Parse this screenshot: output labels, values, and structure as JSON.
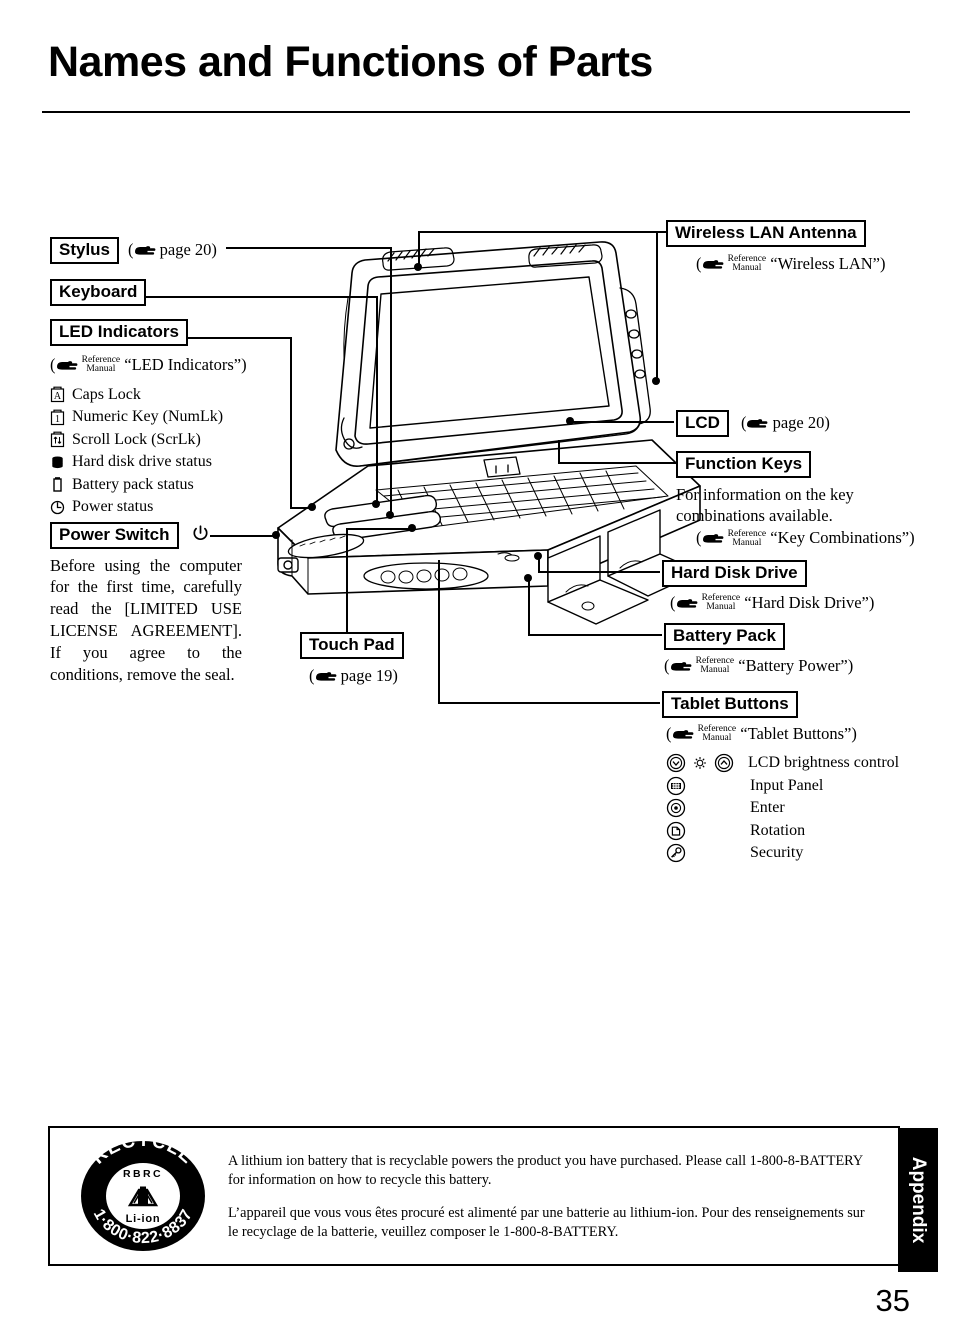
{
  "page": {
    "title": "Names and Functions of Parts",
    "number": "35",
    "tab": "Appendix"
  },
  "ref_manual": {
    "line1": "Reference",
    "line2": "Manual"
  },
  "callouts": {
    "stylus": {
      "label": "Stylus",
      "note": "( page 20)",
      "note_page": "page 20)"
    },
    "keyboard": {
      "label": "Keyboard"
    },
    "led_indicators": {
      "label": "LED Indicators",
      "ref": "“LED Indicators”)",
      "items": [
        {
          "icon": "caps-lock-icon",
          "text": "Caps Lock"
        },
        {
          "icon": "numeric-key-icon",
          "text": "Numeric Key (NumLk)"
        },
        {
          "icon": "scroll-lock-icon",
          "text": "Scroll Lock (ScrLk)"
        },
        {
          "icon": "hard-disk-status-icon",
          "text": "Hard disk drive status"
        },
        {
          "icon": "battery-status-icon",
          "text": "Battery pack status"
        },
        {
          "icon": "power-status-icon",
          "text": "Power status"
        }
      ]
    },
    "power_switch": {
      "label": "Power Switch",
      "body": "Before using the computer for the first time, carefully read the [LIMITED USE LICENSE AGREEMENT]. If you agree to the conditions, remove the seal."
    },
    "touch_pad": {
      "label": "Touch Pad",
      "note_page": "page 19)"
    },
    "wireless_lan": {
      "label": "Wireless LAN Antenna",
      "ref": "“Wireless LAN”)"
    },
    "lcd": {
      "label": "LCD",
      "note_page": "page 20)"
    },
    "function_keys": {
      "label": "Function Keys",
      "body": "For information on the key combinations available.",
      "ref": "“Key Combinations”)"
    },
    "hard_disk_drive": {
      "label": "Hard Disk Drive",
      "ref": "“Hard Disk Drive”)"
    },
    "battery_pack": {
      "label": "Battery Pack",
      "ref": "“Battery Power”)"
    },
    "tablet_buttons": {
      "label": "Tablet Buttons",
      "ref": "“Tablet Buttons”)",
      "items": [
        {
          "icon": "brightness-control-icon",
          "text": "LCD brightness control"
        },
        {
          "icon": "input-panel-icon",
          "text": "Input Panel"
        },
        {
          "icon": "enter-icon",
          "text": "Enter"
        },
        {
          "icon": "rotation-icon",
          "text": "Rotation"
        },
        {
          "icon": "security-icon",
          "text": "Security"
        }
      ]
    }
  },
  "footer": {
    "english": "A lithium ion battery that is recyclable powers the product you have purchased.  Please call 1-800-8-BATTERY for information on how to recycle this battery.",
    "french": "L’appareil que vous vous êtes procuré est alimenté par une batterie au lithium-ion. Pour des renseignements sur le recyclage de la batterie, veuillez composer le 1-800-8-BATTERY.",
    "seal": {
      "top_text": "RECYCLE",
      "bottom_text": "1·800·822·8837",
      "inner_top": "RBRC",
      "inner_bottom": "Li-ion"
    }
  }
}
